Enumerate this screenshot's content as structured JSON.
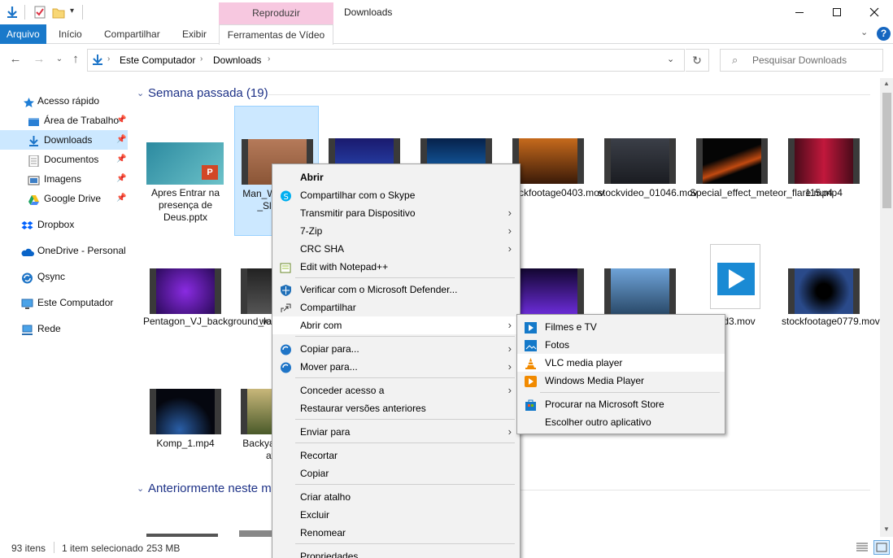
{
  "window": {
    "title": "Downloads",
    "contextual_tab_header": "Reproduzir"
  },
  "ribbon": {
    "tabs": [
      "Arquivo",
      "Início",
      "Compartilhar",
      "Exibir",
      "Ferramentas de Vídeo"
    ],
    "help": "?"
  },
  "address": {
    "crumbs": [
      "Este Computador",
      "Downloads"
    ],
    "search_placeholder": "Pesquisar Downloads"
  },
  "sidebar": {
    "items": [
      {
        "label": "Acesso rápido",
        "icon": "star-icon"
      },
      {
        "label": "Área de Trabalho",
        "icon": "desktop-folder-icon",
        "pinned": true
      },
      {
        "label": "Downloads",
        "icon": "download-arrow-icon",
        "pinned": true,
        "selected": true
      },
      {
        "label": "Documentos",
        "icon": "document-icon",
        "pinned": true
      },
      {
        "label": "Imagens",
        "icon": "image-icon",
        "pinned": true
      },
      {
        "label": "Google Drive",
        "icon": "google-drive-icon",
        "pinned": true
      },
      {
        "label": "Dropbox",
        "icon": "dropbox-icon"
      },
      {
        "label": "OneDrive - Personal",
        "icon": "cloud-icon"
      },
      {
        "label": "Qsync",
        "icon": "sync-icon"
      },
      {
        "label": "Este Computador",
        "icon": "computer-icon"
      },
      {
        "label": "Rede",
        "icon": "network-icon"
      }
    ]
  },
  "content": {
    "group1": "Semana passada (19)",
    "group2": "Anteriormente neste m",
    "files": [
      {
        "name": "Apres Entrar na presença de Deus.pptx"
      },
      {
        "name": "Man_W _the_Pi _Slow_M"
      },
      {
        "name": ""
      },
      {
        "name": ""
      },
      {
        "name": "stockfootage0403.mov"
      },
      {
        "name": "stockvideo_01046.mov"
      },
      {
        "name": "Special_effect_meteor_flare.mp4"
      },
      {
        "name": "115.mp4"
      },
      {
        "name": "Pentagon_VJ_background_loop.mp4"
      },
      {
        "name": "water_s"
      },
      {
        "name": "wind3.mov"
      },
      {
        "name": "stockfootage0779.mov"
      },
      {
        "name": "Komp_1.mp4"
      },
      {
        "name": "Backya ng_Bac ation"
      }
    ]
  },
  "context_menu": {
    "items": [
      "Abrir",
      "Compartilhar com o Skype",
      "Transmitir para Dispositivo",
      "7-Zip",
      "CRC SHA",
      "Edit with Notepad++",
      "Verificar com o Microsoft Defender...",
      "Compartilhar",
      "Abrir com",
      "Copiar para...",
      "Mover para...",
      "Conceder acesso a",
      "Restaurar versões anteriores",
      "Enviar para",
      "Recortar",
      "Copiar",
      "Criar atalho",
      "Excluir",
      "Renomear",
      "Propriedades"
    ]
  },
  "submenu": {
    "items": [
      "Filmes e TV",
      "Fotos",
      "VLC media player",
      "Windows Media Player",
      "Procurar na Microsoft Store",
      "Escolher outro aplicativo"
    ]
  },
  "status": {
    "count": "93 itens",
    "selection": "1 item selecionado",
    "size": "253 MB"
  },
  "colors": {
    "accent": "#1979ca",
    "selection": "#cce8ff",
    "group_header": "#1e3287",
    "contextual_tab": "#f7c8e0"
  }
}
